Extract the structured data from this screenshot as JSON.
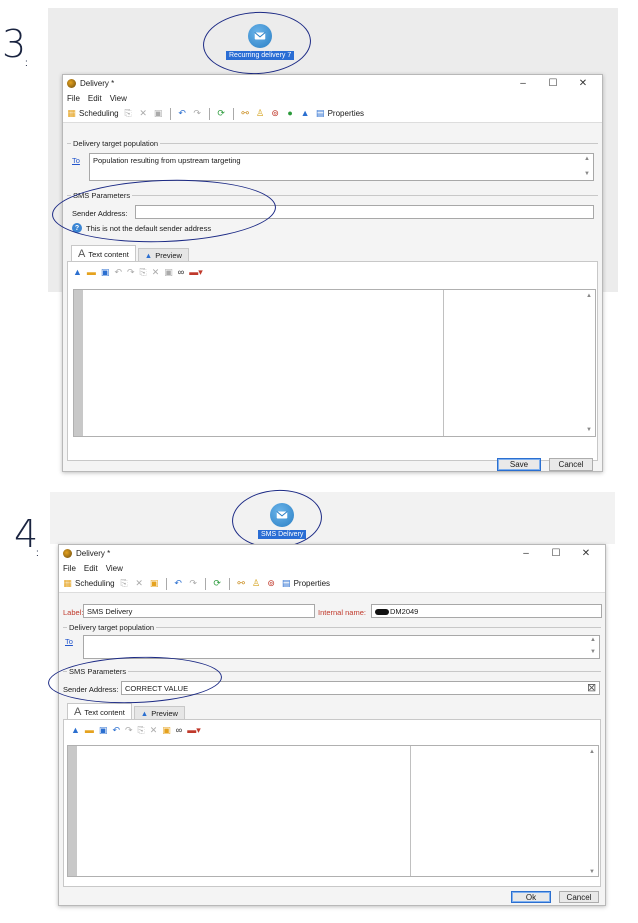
{
  "step3": {
    "step_number": "3",
    "workflow_node_label": "Recurring delivery 7",
    "window": {
      "title": "Delivery *",
      "menu": [
        "File",
        "Edit",
        "View"
      ],
      "toolbar": {
        "scheduling": "Scheduling",
        "properties": "Properties"
      },
      "target_group_title": "Delivery target population",
      "to_link": "To",
      "target_value": "Population resulting from upstream targeting",
      "sms_group_title": "SMS Parameters",
      "sender_label": "Sender Address:",
      "sender_value": "",
      "warning_text": "This is not the default sender address",
      "tabs": [
        "Text content",
        "Preview"
      ],
      "buttons": {
        "save": "Save",
        "cancel": "Cancel"
      }
    }
  },
  "step4": {
    "step_number": "4",
    "workflow_node_label": "SMS Delivery",
    "window": {
      "title": "Delivery *",
      "menu": [
        "File",
        "Edit",
        "View"
      ],
      "toolbar": {
        "scheduling": "Scheduling",
        "properties": "Properties"
      },
      "label_caption": "Label:",
      "label_value": "SMS Delivery",
      "internal_name_caption": "Internal name:",
      "internal_name_value": "DM2049",
      "target_group_title": "Delivery target population",
      "to_link": "To",
      "target_value": "",
      "sms_group_title": "SMS Parameters",
      "sender_label": "Sender Address:",
      "sender_value": "CORRECT VALUE",
      "tabs": [
        "Text content",
        "Preview"
      ],
      "buttons": {
        "ok": "Ok",
        "cancel": "Cancel"
      }
    }
  },
  "icons": {
    "window_controls": [
      "minimize-icon",
      "maximize-icon",
      "close-icon"
    ],
    "workflow_node": "sms-envelope-icon"
  },
  "colors": {
    "selection": "#2a6dd4",
    "annotation": "#1c2a85",
    "link": "#2255cc",
    "label_red": "#c0392b"
  }
}
